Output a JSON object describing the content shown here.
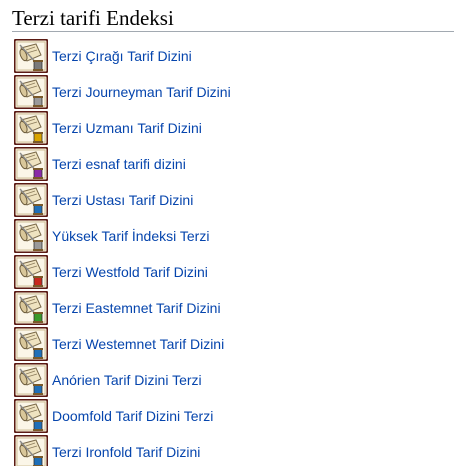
{
  "page": {
    "heading": "Terzi tarifi Endeksi"
  },
  "icon": {
    "name": "recipe-scroll-icon",
    "frame_color": "#5a1a14",
    "paper_color": "#efe3c0",
    "needle_color": "#8a8a8a"
  },
  "items": [
    {
      "label": "Terzi Çırağı Tarif Dizini",
      "accent": "#7a7a7a"
    },
    {
      "label": "Terzi Journeyman Tarif Dizini",
      "accent": "#9a9a9a"
    },
    {
      "label": "Terzi Uzmanı Tarif Dizini",
      "accent": "#d9a400"
    },
    {
      "label": "Terzi esnaf tarifi dizini",
      "accent": "#8a2aa8"
    },
    {
      "label": "Terzi Ustası Tarif Dizini",
      "accent": "#1f6fb8"
    },
    {
      "label": "Yüksek Tarif İndeksi Terzi",
      "accent": "#9a9a9a"
    },
    {
      "label": "Terzi Westfold Tarif Dizini",
      "accent": "#c8281e"
    },
    {
      "label": "Terzi Eastemnet Tarif Dizini",
      "accent": "#3a9a2a"
    },
    {
      "label": "Terzi Westemnet Tarif Dizini",
      "accent": "#1f6fb8"
    },
    {
      "label": "Anórien Tarif Dizini Terzi",
      "accent": "#1f6fb8"
    },
    {
      "label": "Doomfold Tarif Dizini Terzi",
      "accent": "#1f6fb8"
    },
    {
      "label": "Terzi Ironfold Tarif Dizini",
      "accent": "#1f6fb8"
    }
  ]
}
